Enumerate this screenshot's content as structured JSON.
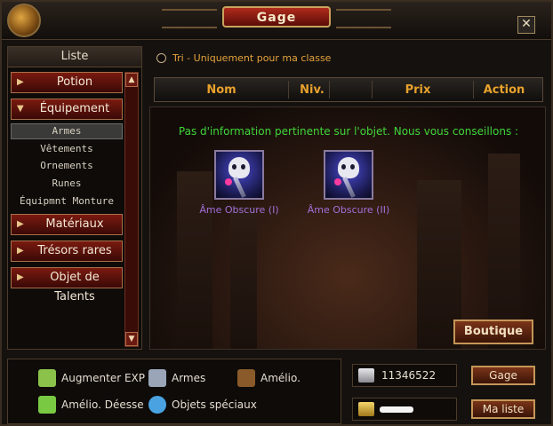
{
  "window": {
    "title": "Gage",
    "close_label": "✕"
  },
  "sidebar": {
    "header": "Liste",
    "categories": [
      {
        "label": "Potion",
        "arrow": "▶"
      },
      {
        "label": "Équipement",
        "arrow": "▼"
      },
      {
        "label": "Matériaux",
        "arrow": "▶"
      },
      {
        "label": "Trésors rares",
        "arrow": "▶"
      },
      {
        "label": "Objet de Talents",
        "arrow": "▶"
      }
    ],
    "subitems": [
      {
        "label": "Armes",
        "selected": true
      },
      {
        "label": "Vêtements",
        "selected": false
      },
      {
        "label": "Ornements",
        "selected": false
      },
      {
        "label": "Runes",
        "selected": false
      },
      {
        "label": "Équipmnt Monture",
        "selected": false
      }
    ],
    "scroll_up": "▲",
    "scroll_down": "▼"
  },
  "filter": {
    "label": "Tri - Uniquement pour ma classe",
    "checked": false
  },
  "columns": [
    "Nom",
    "Niv.",
    "Prix",
    "Action"
  ],
  "info_message": "Pas d'information pertinente sur l'objet. Nous vous conseillons :",
  "suggestions": [
    {
      "label": "Âme Obscure (I)",
      "icon": "dark-soul-staff-icon"
    },
    {
      "label": "Âme Obscure (II)",
      "icon": "dark-soul-staff-icon"
    }
  ],
  "shop_button": "Boutique",
  "shortcuts": [
    {
      "label": "Augmenter EXP",
      "icon": "exp-potion-icon",
      "color": "#8bc34a"
    },
    {
      "label": "Armes",
      "icon": "weapons-icon",
      "color": "#9aa6b8"
    },
    {
      "label": "Amélio.",
      "icon": "upgrade-arrow-icon",
      "color": "#8a5a2a"
    },
    {
      "label": "Amélio. Déesse",
      "icon": "goddess-flask-icon",
      "color": "#7ac943"
    },
    {
      "label": "Objets spéciaux",
      "icon": "special-orb-icon",
      "color": "#4aa3e0"
    }
  ],
  "currency": {
    "silver": "11346522",
    "gold": ""
  },
  "buttons": {
    "gage": "Gage",
    "my_list": "Ma liste"
  },
  "colors": {
    "accent_orange": "#e8a12c",
    "info_green": "#40d63a",
    "item_purple": "#a26fd8",
    "button_red": "#7a1a10"
  }
}
